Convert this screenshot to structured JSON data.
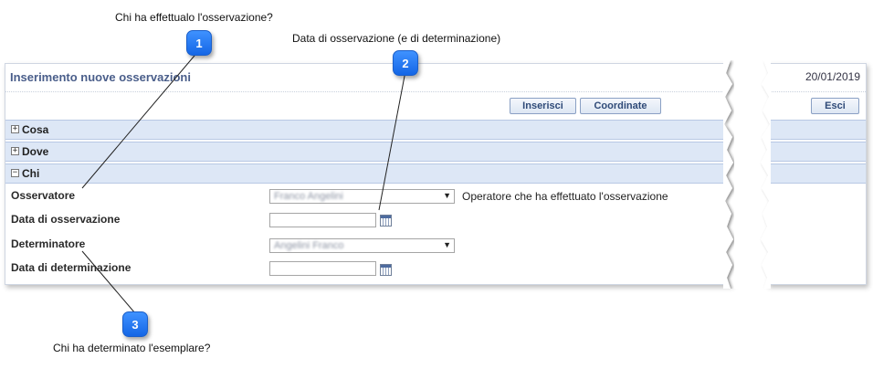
{
  "callouts": {
    "c1": {
      "number": "1",
      "text": "Chi ha effettualo l'osservazione?"
    },
    "c2": {
      "number": "2",
      "text": "Data di osservazione (e di determinazione)"
    },
    "c3": {
      "number": "3",
      "text": "Chi ha determinato l'esemplare?"
    }
  },
  "header": {
    "title": "Inserimento nuove osservazioni",
    "date": "20/01/2019"
  },
  "toolbar": {
    "insert_label": "Inserisci",
    "coords_label": "Coordinate",
    "exit_label": "Esci"
  },
  "sections": {
    "cosa": {
      "label": "Cosa",
      "toggle": "+"
    },
    "dove": {
      "label": "Dove",
      "toggle": "+"
    },
    "chi": {
      "label": "Chi",
      "toggle": "−"
    }
  },
  "form": {
    "observer_label": "Osservatore",
    "observer_value": "Franco Angelini",
    "observer_hint": "Operatore che ha effettuato l'osservazione",
    "obs_date_label": "Data di osservazione",
    "obs_date_value": "",
    "determiner_label": "Determinatore",
    "determiner_value": "Angelini Franco",
    "det_date_label": "Data di determinazione",
    "det_date_value": ""
  },
  "colors": {
    "badge": "#1f73f0",
    "section_bar": "#dde7f6",
    "title": "#4a5e8a"
  },
  "icons": {
    "calendar": "calendar-icon",
    "dropdown": "chevron-down-icon"
  }
}
